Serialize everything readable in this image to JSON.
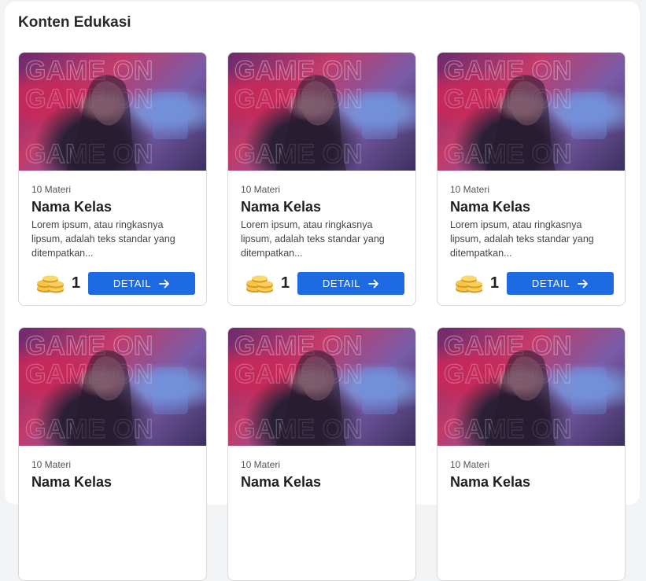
{
  "section": {
    "title": "Konten Edukasi"
  },
  "cards": [
    {
      "materi": "10 Materi",
      "name": "Nama Kelas",
      "description": "Lorem ipsum, atau ringkasnya lipsum, adalah teks standar yang ditempatkan...",
      "points": "1",
      "button_label": "DETAIL",
      "thumb_text": "GAME ON"
    },
    {
      "materi": "10 Materi",
      "name": "Nama Kelas",
      "description": "Lorem ipsum, atau ringkasnya lipsum, adalah teks standar yang ditempatkan...",
      "points": "1",
      "button_label": "DETAIL",
      "thumb_text": "GAME ON"
    },
    {
      "materi": "10 Materi",
      "name": "Nama Kelas",
      "description": "Lorem ipsum, atau ringkasnya lipsum, adalah teks standar yang ditempatkan...",
      "points": "1",
      "button_label": "DETAIL",
      "thumb_text": "GAME ON"
    },
    {
      "materi": "10 Materi",
      "name": "Nama Kelas",
      "description": "",
      "points": "",
      "button_label": "",
      "thumb_text": "GAME ON"
    },
    {
      "materi": "10 Materi",
      "name": "Nama Kelas",
      "description": "",
      "points": "",
      "button_label": "",
      "thumb_text": "GAME ON"
    },
    {
      "materi": "10 Materi",
      "name": "Nama Kelas",
      "description": "",
      "points": "",
      "button_label": "",
      "thumb_text": "GAME ON"
    }
  ],
  "icons": {
    "points": "coin-stack-icon",
    "button": "arrow-right-icon"
  },
  "colors": {
    "accent": "#1e6ae3",
    "card_border": "#d9d9d9"
  }
}
